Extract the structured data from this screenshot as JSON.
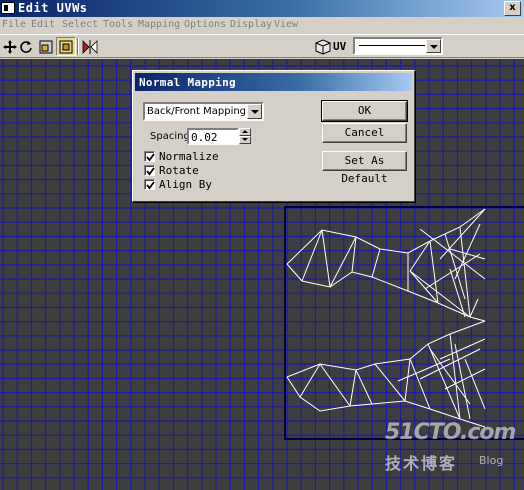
{
  "window": {
    "title": "Edit UVWs",
    "close_label": "x"
  },
  "menu": [
    "File",
    "Edit",
    "Select",
    "Tools",
    "Mapping",
    "Options",
    "Display",
    "View"
  ],
  "toolbar": {
    "tools": [
      {
        "name": "move-icon",
        "pressed": false
      },
      {
        "name": "rotate-icon",
        "pressed": false
      },
      {
        "name": "scale-icon",
        "pressed": false
      },
      {
        "name": "freeform-icon",
        "pressed": true
      },
      {
        "name": "mirror-icon",
        "pressed": false
      }
    ],
    "uv_label": "UV",
    "map_combo_value": ""
  },
  "dialog": {
    "title": "Normal Mapping",
    "mapping_value": "Back/Front Mapping",
    "spacing_label": "Spacing:",
    "spacing_value": "0.02",
    "checkboxes": [
      {
        "label": "Normalize",
        "checked": true
      },
      {
        "label": "Rotate",
        "checked": true
      },
      {
        "label": "Align By",
        "checked": true
      }
    ],
    "ok_label": "OK",
    "cancel_label": "Cancel",
    "default_label": "Set As Default"
  },
  "watermark": {
    "main": "51CTO.com",
    "sub": "技术博客",
    "blog": "Blog"
  },
  "colors": {
    "grid": "#1c1ca0",
    "background": "#3e3e3e",
    "mesh": "#ffffff",
    "uv_frame": "#000040"
  }
}
